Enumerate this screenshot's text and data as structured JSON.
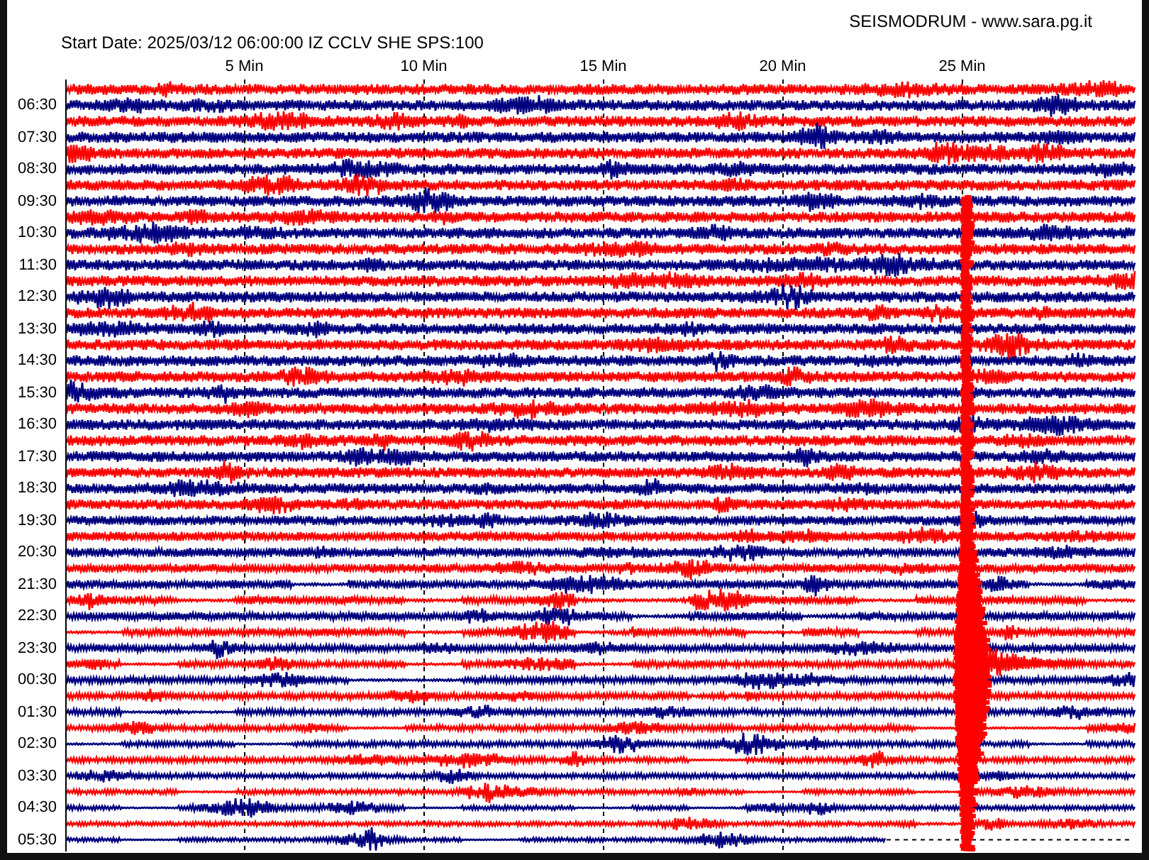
{
  "title": "SEISMODRUM - www.sara.pg.it",
  "start_info": "Start Date: 2025/03/12 06:00:00 IZ CCLV SHE SPS:100",
  "minute_ticks": [
    "5 Min",
    "10 Min",
    "15 Min",
    "20 Min",
    "25 Min"
  ],
  "hour_labels": [
    "06:30",
    "07:30",
    "08:30",
    "09:30",
    "10:30",
    "11:30",
    "12:30",
    "13:30",
    "14:30",
    "15:30",
    "16:30",
    "17:30",
    "18:30",
    "19:30",
    "20:30",
    "21:30",
    "22:30",
    "23:30",
    "00:30",
    "01:30",
    "02:30",
    "03:30",
    "04:30",
    "05:30"
  ],
  "traces": [
    {
      "color": "#ff0000"
    },
    {
      "color": "#000080"
    },
    {
      "color": "#ff0000"
    },
    {
      "color": "#000080"
    },
    {
      "color": "#ff0000"
    },
    {
      "color": "#000080"
    },
    {
      "color": "#ff0000"
    },
    {
      "color": "#000080"
    },
    {
      "color": "#ff0000"
    },
    {
      "color": "#000080"
    },
    {
      "color": "#ff0000"
    },
    {
      "color": "#000080"
    },
    {
      "color": "#ff0000"
    },
    {
      "color": "#000080"
    },
    {
      "color": "#ff0000"
    },
    {
      "color": "#000080"
    },
    {
      "color": "#ff0000"
    },
    {
      "color": "#000080"
    },
    {
      "color": "#ff0000"
    },
    {
      "color": "#000080"
    },
    {
      "color": "#ff0000"
    },
    {
      "color": "#000080"
    },
    {
      "color": "#ff0000"
    },
    {
      "color": "#000080"
    },
    {
      "color": "#ff0000"
    },
    {
      "color": "#000080"
    },
    {
      "color": "#ff0000"
    },
    {
      "color": "#000080"
    },
    {
      "color": "#ff0000"
    },
    {
      "color": "#000080"
    },
    {
      "color": "#ff0000"
    },
    {
      "color": "#000080"
    },
    {
      "color": "#ff0000"
    },
    {
      "color": "#000080"
    },
    {
      "color": "#ff0000"
    },
    {
      "color": "#000080"
    },
    {
      "color": "#ff0000"
    },
    {
      "color": "#000080"
    },
    {
      "color": "#ff0000"
    },
    {
      "color": "#000080"
    },
    {
      "color": "#ff0000"
    },
    {
      "color": "#000080"
    },
    {
      "color": "#ff0000"
    },
    {
      "color": "#000080"
    },
    {
      "color": "#ff0000"
    },
    {
      "color": "#000080"
    },
    {
      "color": "#ff0000"
    },
    {
      "color": "#000080"
    }
  ]
}
